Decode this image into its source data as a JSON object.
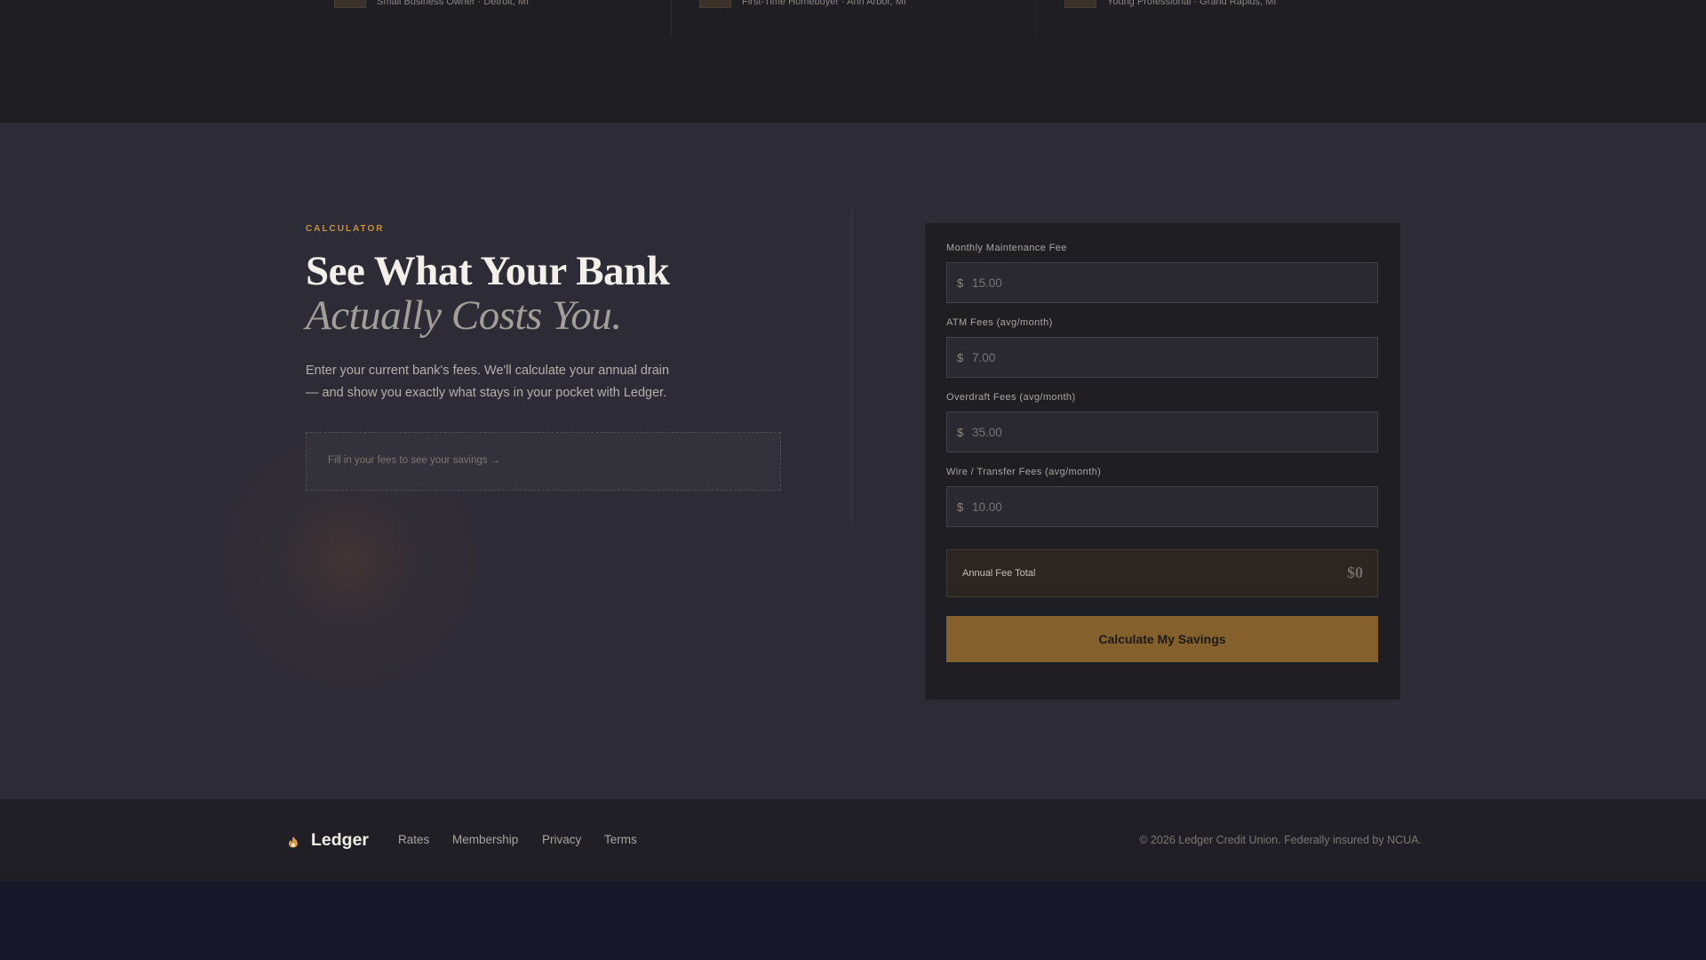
{
  "testimonials": [
    {
      "meta": "Small Business Owner · Detroit, MI"
    },
    {
      "meta": "First-Time Homebuyer · Ann Arbor, MI"
    },
    {
      "meta": "Young Professional · Grand Rapids, MI"
    }
  ],
  "calculator": {
    "eyebrow": "CALCULATOR",
    "headline": "See What Your Bank",
    "headline_italic": "Actually Costs You.",
    "lede": "Enter your current bank's fees. We'll calculate your annual drain — and show you exactly what stays in your pocket with Ledger.",
    "savings_placeholder": "Fill in your fees to see your savings →",
    "fields": [
      {
        "label": "Monthly Maintenance Fee",
        "currency": "$",
        "placeholder": "15.00"
      },
      {
        "label": "ATM Fees (avg/month)",
        "currency": "$",
        "placeholder": "7.00"
      },
      {
        "label": "Overdraft Fees (avg/month)",
        "currency": "$",
        "placeholder": "35.00"
      },
      {
        "label": "Wire / Transfer Fees (avg/month)",
        "currency": "$",
        "placeholder": "10.00"
      }
    ],
    "total_label": "Annual Fee Total",
    "total_value": "$0",
    "button_label": "Calculate My Savings"
  },
  "footer": {
    "brand": "Ledger",
    "brand_icon": "flame-icon",
    "links": [
      "Rates",
      "Membership",
      "Privacy",
      "Terms"
    ],
    "copyright": "© 2026 Ledger Credit Union. Federally insured by NCUA."
  },
  "colors": {
    "accent": "#c8913a",
    "button": "#84612c",
    "section_bg": "#2d2c36",
    "card_bg": "#1f1e22"
  }
}
